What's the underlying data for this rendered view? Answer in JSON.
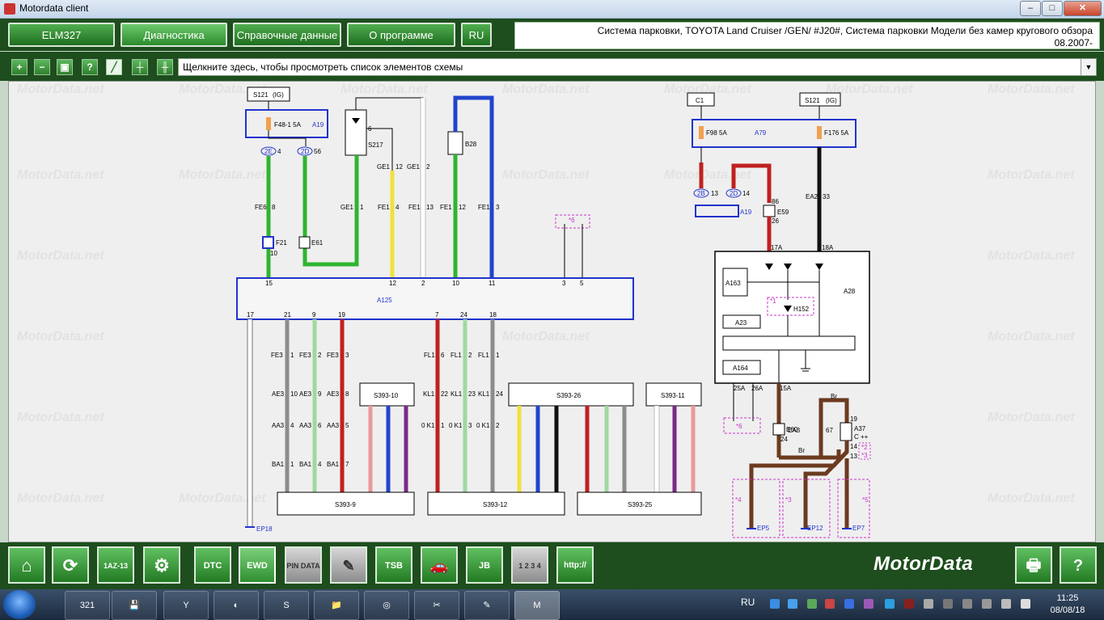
{
  "window": {
    "title": "Motordata client",
    "minimize": "–",
    "maximize": "□",
    "close": "✕"
  },
  "menu": {
    "items": [
      {
        "label": "ELM327"
      },
      {
        "label": "Диагностика"
      },
      {
        "label": "Справочные данные"
      },
      {
        "label": "О программе"
      },
      {
        "label": "RU"
      }
    ],
    "breadcrumb_line1": "Система парковки, TOYOTA  Land Cruiser /GEN/  #J20#,   Система парковки  Модели без камер кругового обзора",
    "breadcrumb_line2": "08.2007-"
  },
  "toolbar": {
    "buttons": [
      {
        "icon": "zoom-in-icon",
        "glyph": "+"
      },
      {
        "icon": "zoom-out-icon",
        "glyph": "−"
      },
      {
        "icon": "fit-view-icon",
        "glyph": "▣"
      },
      {
        "icon": "help-icon",
        "glyph": "?"
      },
      {
        "icon": "highlight-wire-icon",
        "glyph": "╱"
      },
      {
        "icon": "grid-icon",
        "glyph": "┼"
      },
      {
        "icon": "connector-icon",
        "glyph": "╫"
      }
    ],
    "select_text": "Щелкните здесь, чтобы просмотреть список элементов схемы",
    "select_arrow": "▼"
  },
  "diagram": {
    "watermark": "MotorData.net",
    "colors": {
      "green": "#2fb52f",
      "light_green": "#9fd99f",
      "yellow": "#f0e040",
      "white": "#ffffff",
      "blue": "#2244cc",
      "gray": "#8c8c8c",
      "red": "#c02020",
      "pink": "#e89a9a",
      "violet": "#7a2a8a",
      "black": "#111111",
      "brown": "#6b3a1f",
      "frame_blue": "#2233cc",
      "magenta": "#cc33cc"
    },
    "labels": {
      "s121_left": "S121",
      "ig": "(IG)",
      "fuse_left": "F48-1 5A",
      "a19_top": "A19",
      "pin_2e": "2E",
      "pin_2e_n": "4",
      "pin_2d": "2D",
      "pin_2d_n": "56",
      "fe6": "FE6",
      "fe6_n": "8",
      "f21": "F21",
      "f21_n": "10",
      "e61": "E61",
      "s217": "S217",
      "s217_n": "6",
      "b28": "B28",
      "ge1_a": "GE1",
      "ge1_a_n": "12",
      "ge1_b": "GE1",
      "ge1_b_n": "2",
      "ge1_c": "GE1",
      "ge1_c_n": "1",
      "fe1_a": "FE1",
      "fe1_a_n": "4",
      "fe1_b": "FE1",
      "fe1_b_n": "13",
      "fe1_c": "FE1",
      "fe1_c_n": "12",
      "fe1_d": "FE1",
      "fe1_d_n": "3",
      "star6": "*6",
      "a125": "A125",
      "a125_top_pins": [
        "15",
        "12",
        "2",
        "10",
        "11",
        "3",
        "5"
      ],
      "a125_bottom_pins": [
        "17",
        "21",
        "9",
        "19",
        "7",
        "24",
        "18"
      ],
      "fe3": "FE3",
      "fe3_pins": [
        "1",
        "2",
        "3"
      ],
      "ae3": "AE3",
      "ae3_pins": [
        "10",
        "9",
        "8"
      ],
      "aa3": "AA3",
      "aa3_pins": [
        "4",
        "6",
        "5"
      ],
      "ba1": "BA1",
      "ba1_pins": [
        "1",
        "4",
        "7"
      ],
      "fl1": "FL1",
      "fl1_pins": [
        "6",
        "2",
        "1"
      ],
      "kl1": "KL1",
      "kl1_pins": [
        "22",
        "23",
        "24"
      ],
      "ok1": "0 K1",
      "ok1_pins": [
        "1",
        "3",
        "2"
      ],
      "s393_10": "S393-10",
      "s393_26": "S393-26",
      "s393_11": "S393-11",
      "s393_9": "S393-9",
      "s393_12": "S393-12",
      "s393_25": "S393-25",
      "ep18": "EP18",
      "c1": "C1",
      "s121_right": "S121",
      "fuse_r1": "F98 5A",
      "fuse_r2": "F176 5A",
      "a79": "A79",
      "pin_2b": "2B",
      "pin_2b_n": "13",
      "pin_2d_r": "2D",
      "pin_2d_r_n": "14",
      "a19_right": "A19",
      "e59": "E59",
      "e59_n1": "86",
      "e59_n2": "26",
      "ea2": "EA2",
      "ea2_n": "33",
      "a28": "A28",
      "a163": "A163",
      "a23": "A23",
      "a164": "A164",
      "h152": "H152",
      "pin_17a": "17A",
      "pin_18a": "18A",
      "pin_25a": "25A",
      "pin_26a": "26A",
      "pin_15a": "15A",
      "e60": "E60",
      "e60_n": "24",
      "ea3": "EA3",
      "ea3_n": "67",
      "a37": "A37",
      "a37_c": "C ++",
      "a37_pins": [
        "19",
        "14",
        "13"
      ],
      "br": "Br",
      "star2": "*2",
      "star3": "*3",
      "star4": "*4",
      "star5": "*5",
      "star1": "*1",
      "ep5": "EP5",
      "ep12": "EP12",
      "ep7": "EP7"
    }
  },
  "bottom": {
    "icons": [
      {
        "name": "home-icon",
        "label": "⌂"
      },
      {
        "name": "refresh-icon",
        "label": "⟳"
      },
      {
        "name": "engine-code-icon",
        "label": "1AZ-13"
      },
      {
        "name": "gear-icon",
        "label": "⚙"
      },
      {
        "name": "dtc-icon",
        "label": "DTC"
      },
      {
        "name": "ewd-icon",
        "label": "EWD"
      },
      {
        "name": "pin-data-icon",
        "label": "PIN DATA"
      },
      {
        "name": "tester-icon",
        "label": "✎"
      },
      {
        "name": "tsb-icon",
        "label": "TSB"
      },
      {
        "name": "vehicle-icon",
        "label": "🚗"
      },
      {
        "name": "jb-icon",
        "label": "JB"
      },
      {
        "name": "relay-icon",
        "label": "1 2 3 4"
      },
      {
        "name": "http-icon",
        "label": "http://"
      }
    ],
    "brand": "MotorData",
    "print_icon": "🖶",
    "help_icon": "?"
  },
  "taskbar": {
    "apps": [
      "321",
      "💾",
      "Y",
      "◐",
      "S",
      "📁",
      "◎",
      "✂",
      "✎",
      "M"
    ],
    "lang": "RU",
    "time": "11:25",
    "date": "08/08/18"
  }
}
